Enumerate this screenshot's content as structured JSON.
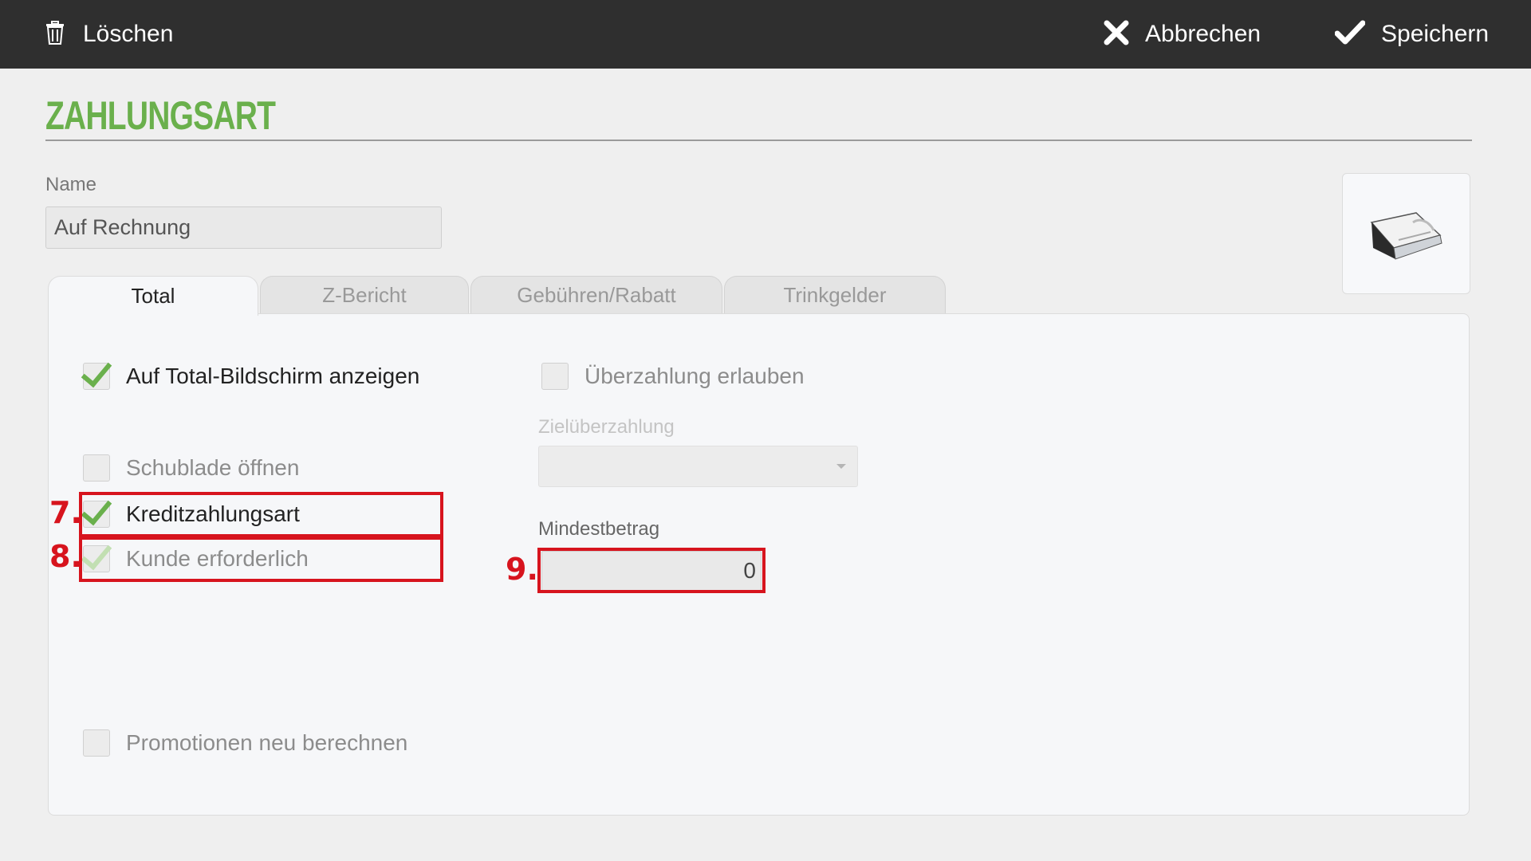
{
  "toolbar": {
    "delete_label": "Löschen",
    "cancel_label": "Abbrechen",
    "save_label": "Speichern"
  },
  "header": {
    "title": "ZAHLUNGSART"
  },
  "name_field": {
    "label": "Name",
    "value": "Auf Rechnung"
  },
  "tabs": [
    {
      "label": "Total",
      "active": true
    },
    {
      "label": "Z-Bericht",
      "active": false
    },
    {
      "label": "Gebühren/Rabatt",
      "active": false
    },
    {
      "label": "Trinkgelder",
      "active": false
    }
  ],
  "options": {
    "show_on_total": {
      "label": "Auf Total-Bildschirm anzeigen",
      "checked": true
    },
    "open_drawer": {
      "label": "Schublade öffnen",
      "checked": false
    },
    "credit_payment": {
      "label": "Kreditzahlungsart",
      "checked": true
    },
    "customer_required": {
      "label": "Kunde erforderlich",
      "checked": true,
      "enabled": false
    },
    "recalc_promotions": {
      "label": "Promotionen neu berechnen",
      "checked": false
    },
    "allow_overpayment": {
      "label": "Überzahlung erlauben",
      "checked": false
    }
  },
  "target_overpayment": {
    "label": "Zielüberzahlung",
    "value": ""
  },
  "minimum_amount": {
    "label": "Mindestbetrag",
    "value": "0"
  },
  "annotations": [
    "7.",
    "8.",
    "9."
  ],
  "colors": {
    "accent": "#6ab04c",
    "toolbar": "#2f2f2f",
    "highlight": "#d7141e"
  },
  "icons": [
    "trash-icon",
    "close-icon",
    "check-icon",
    "payment-image-icon"
  ]
}
